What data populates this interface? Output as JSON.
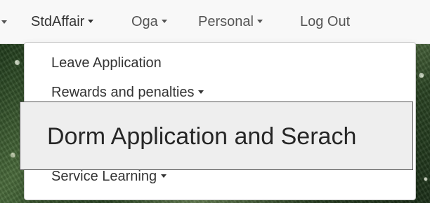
{
  "navbar": {
    "items": [
      {
        "label": "StdAffair"
      },
      {
        "label": "Oga"
      },
      {
        "label": "Personal"
      },
      {
        "label": "Log Out"
      }
    ]
  },
  "dropdown": {
    "items": [
      {
        "label": "Leave Application"
      },
      {
        "label": "Rewards and penalties"
      },
      {
        "label": "Dorm Application and Serach"
      },
      {
        "label": "Service Learning"
      }
    ]
  }
}
